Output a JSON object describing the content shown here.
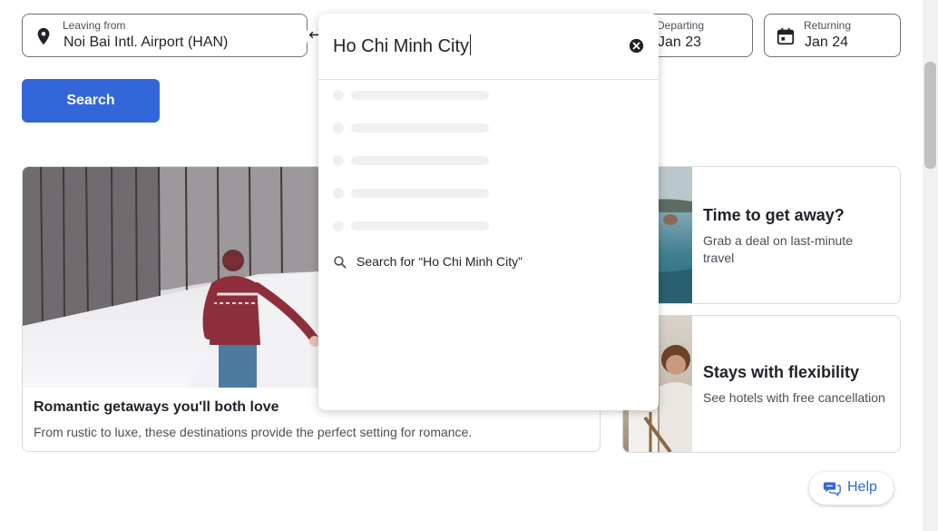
{
  "form": {
    "leaving": {
      "label": "Leaving from",
      "value": "Noi Bai Intl. Airport (HAN)"
    },
    "departing": {
      "label": "Departing",
      "value": "Jan 23"
    },
    "returning": {
      "label": "Returning",
      "value": "Jan 24"
    },
    "search_label": "Search"
  },
  "dropdown": {
    "input_value": "Ho Chi Minh City",
    "suggestion": "Search for “Ho Chi Minh City”"
  },
  "cards": {
    "romantic": {
      "title": "Romantic getaways you'll both love",
      "subtitle": "From rustic to luxe, these destinations provide the perfect setting for romance."
    },
    "getaway": {
      "title": "Time to get away?",
      "subtitle": "Grab a deal on last-minute travel"
    },
    "flexibility": {
      "title": "Stays with flexibility",
      "subtitle": "See hotels with free cancellation"
    }
  },
  "help": {
    "label": "Help"
  },
  "colors": {
    "accent": "#3366d9",
    "text": "#1f2328",
    "border": "#d7d9de"
  },
  "icons": [
    "location-pin-icon",
    "swap-icon",
    "calendar-icon",
    "clear-icon",
    "search-icon",
    "chat-icon"
  ]
}
